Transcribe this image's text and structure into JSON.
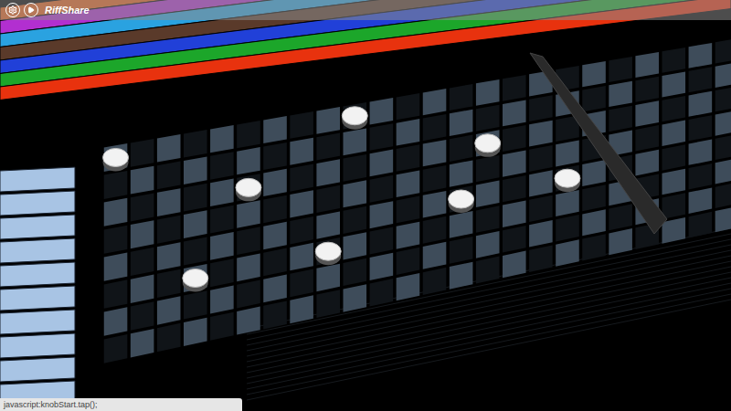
{
  "app": {
    "title": "RiffShare"
  },
  "tracks": [
    {
      "color": "#e8601a"
    },
    {
      "color": "#b22fd0"
    },
    {
      "color": "#2aa2e0"
    },
    {
      "color": "#5a3a2a"
    },
    {
      "color": "#2140d8"
    },
    {
      "color": "#1ca62a"
    },
    {
      "color": "#e8320e"
    }
  ],
  "notes": [
    {
      "step": 0,
      "pitch": 0
    },
    {
      "step": 3,
      "pitch": 5
    },
    {
      "step": 5,
      "pitch": 2
    },
    {
      "step": 8,
      "pitch": 5
    },
    {
      "step": 9,
      "pitch": 0
    },
    {
      "step": 13,
      "pitch": 4
    },
    {
      "step": 14,
      "pitch": 2
    },
    {
      "step": 17,
      "pitch": 4
    }
  ],
  "status_bar": "javascript:knobStart.tap();"
}
